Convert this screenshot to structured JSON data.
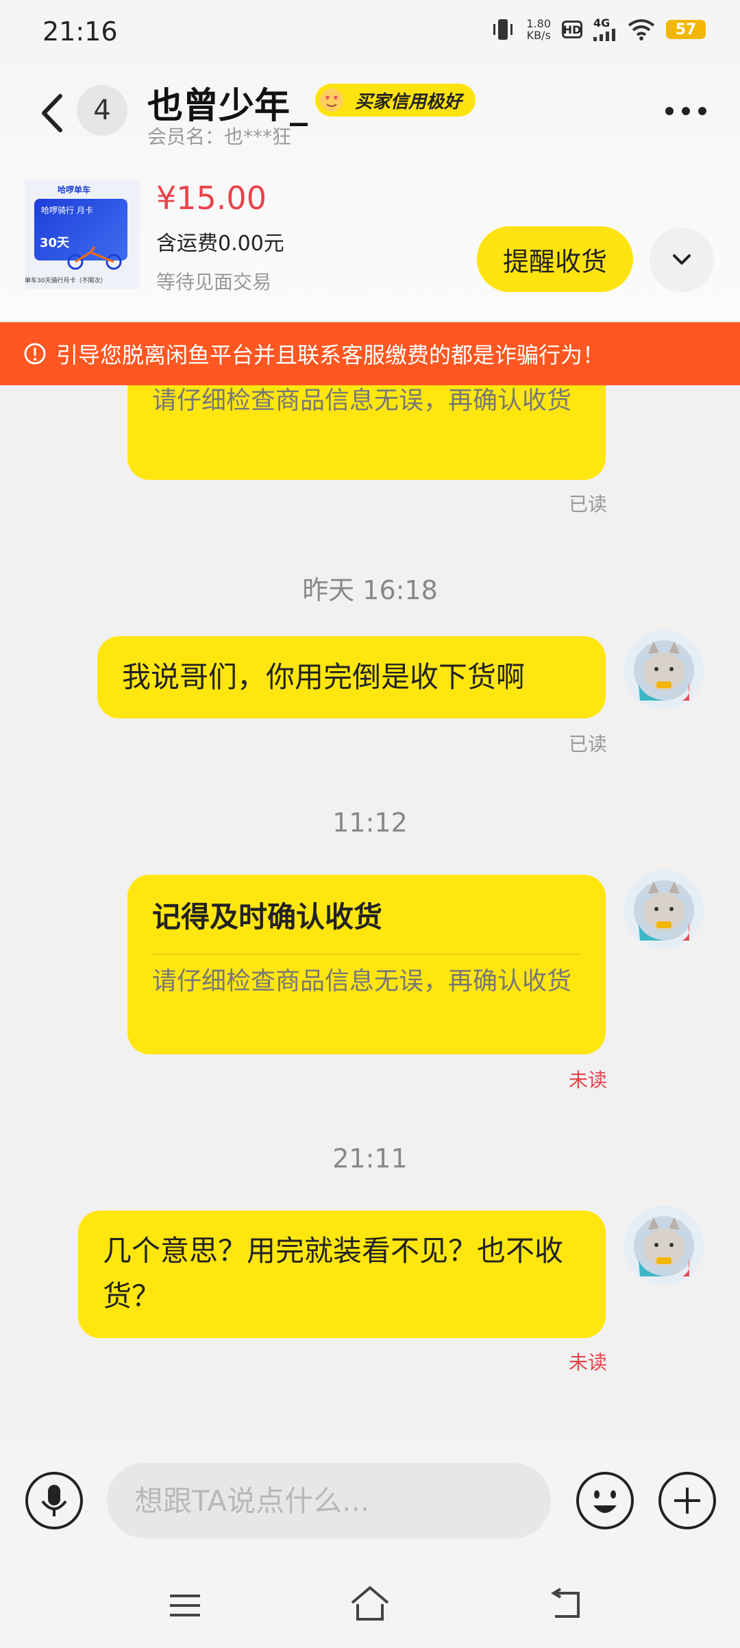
{
  "status_bar": {
    "time": "21:16",
    "net_speed_value": "1.80",
    "net_speed_unit": "KB/s",
    "hd": "HD",
    "network": "4G",
    "battery": "57"
  },
  "header": {
    "back_count": "4",
    "nickname": "也曾少年_",
    "credit_badge": "买家信用极好",
    "member_name": "会员名：也***狂"
  },
  "product": {
    "image_brand": "哈啰单车",
    "image_card_title": "哈啰骑行 月卡",
    "image_card_days": "30天",
    "image_caption": "单车30天骑行月卡（不限次）",
    "price": "¥15.00",
    "shipping": "含运费0.00元",
    "trade_status": "等待见面交易",
    "remind_label": "提醒收货"
  },
  "warning": {
    "text": "引导您脱离闲鱼平台并且联系客服缴费的都是诈骗行为！"
  },
  "chat": {
    "partial_card_body": "请仔细检查商品信息无误，再确认收货",
    "read_label_1": "已读",
    "timestamp_1": "昨天 16:18",
    "message_1": "我说哥们，你用完倒是收下货啊",
    "read_label_2": "已读",
    "timestamp_2": "11:12",
    "card_title": "记得及时确认收货",
    "card_body": "请仔细检查商品信息无误，再确认收货",
    "read_label_3": "未读",
    "timestamp_3": "21:11",
    "message_2": "几个意思？用完就装看不见？也不收货？",
    "read_label_4": "未读"
  },
  "input": {
    "placeholder": "想跟TA说点什么..."
  },
  "colors": {
    "bubble": "#ffe60f",
    "warning": "#ff5722",
    "price": "#e8434b",
    "unread": "#e8434b"
  },
  "icons": [
    "back-icon",
    "more-icon",
    "chevron-down-icon",
    "warning-icon",
    "mic-icon",
    "emoji-icon",
    "plus-icon",
    "menu-icon",
    "home-icon",
    "back-nav-icon",
    "avatar-cat"
  ]
}
